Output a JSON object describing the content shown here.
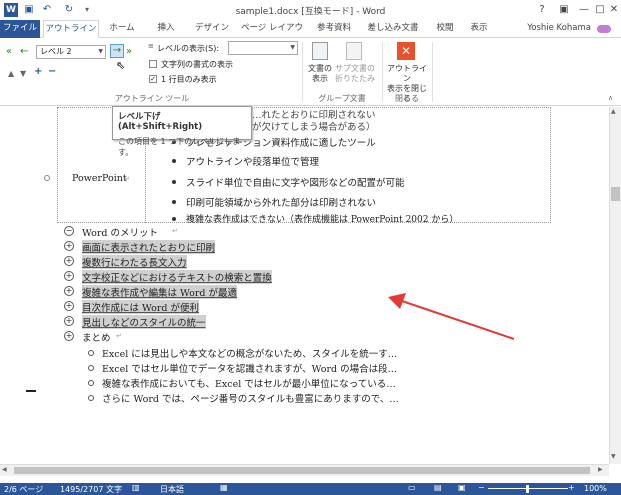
{
  "window": {
    "title": "sample1.docx [互換モード] - Word",
    "help": "?",
    "minimize": "—",
    "maximize": "□",
    "close": "✕"
  },
  "tabs": [
    "ファイル",
    "アウトライン",
    "ホーム",
    "挿入",
    "デザイン",
    "ページ レイアウト",
    "参考資料",
    "差し込み文書",
    "校閲",
    "表示"
  ],
  "user": "Yoshie Kohama",
  "ribbon": {
    "level_value": "レベル 2",
    "show_level_label": "レベルの表示(S):",
    "show_format_label": "文字列の書式の表示",
    "first_line_label": "1 行目のみ表示",
    "group_outline": "アウトライン ツール",
    "btn_show_doc_1": "文書の",
    "btn_show_doc_2": "表示",
    "btn_collapse_1": "サブ文書の",
    "btn_collapse_2": "折りたたみ",
    "group_master": "グループ文書",
    "btn_close_1": "アウトライン",
    "btn_close_2": "表示を閉じる",
    "group_close": "閉じる"
  },
  "tooltip": {
    "title": "レベル下げ (Alt+Shift+Right)",
    "desc": "この項目を 1 つ下のレベルにします。"
  },
  "doc": {
    "cut_line1": "…れたとおりに印刷されない",
    "cut_line2": "が欠けてしまう場合がある）",
    "table_label": "PowerPoint",
    "ppt_items": [
      "プレゼンテーション資料作成に適したツール",
      "アウトラインや段落単位で管理",
      "スライド単位で自由に文字や図形などの配置が可能",
      "印刷可能領域から外れた部分は印刷されない",
      "複雑な表作成はできない（表作成機能は PowerPoint 2002 から）"
    ],
    "heading": "Word のメリット",
    "merits": [
      "画面に表示されたとおりに印刷",
      "複数行にわたる長文入力",
      "文字校正などにおけるテキストの検索と置換",
      "複雑な表作成や編集は Word が最適",
      "目次作成には Word が便利",
      "見出しなどのスタイルの統一"
    ],
    "summary": "まとめ",
    "summary_items": [
      "Excel には見出しや本文などの概念がないため、スタイルを統一す…",
      "Excel ではセル単位でデータを認識されますが、Word の場合は段…",
      "複雑な表作成においても、Excel ではセルが最小単位になっている…",
      "さらに Word では、ページ番号のスタイルも豊富にありますので、…"
    ]
  },
  "status": {
    "page": "2/6 ページ",
    "words": "1495/2707 文字",
    "lang": "日本語",
    "zoom": "100%"
  },
  "colors": {
    "accent": "#2b579a",
    "arrow": "#e53935",
    "close_icon": "#e8512a"
  }
}
